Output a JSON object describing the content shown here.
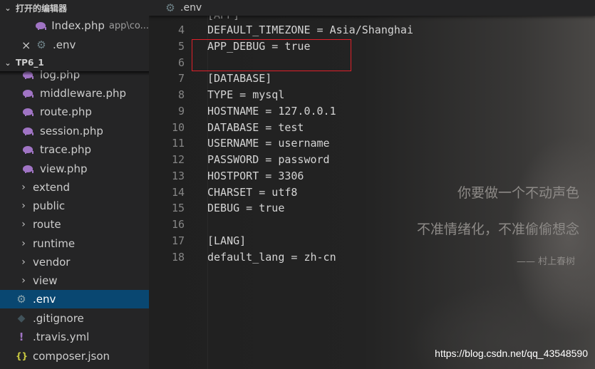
{
  "sidebar": {
    "open_editors_header": "打开的编辑器",
    "open_editors": [
      {
        "name": "Index.php",
        "desc": "app\\co..."
      },
      {
        "name": ".env",
        "close": "×"
      }
    ],
    "project_header": "TP6_1",
    "tree": [
      {
        "label": "log.php",
        "kind": "php"
      },
      {
        "label": "middleware.php",
        "kind": "php"
      },
      {
        "label": "route.php",
        "kind": "php"
      },
      {
        "label": "session.php",
        "kind": "php"
      },
      {
        "label": "trace.php",
        "kind": "php"
      },
      {
        "label": "view.php",
        "kind": "php"
      },
      {
        "label": "extend",
        "kind": "folder"
      },
      {
        "label": "public",
        "kind": "folder"
      },
      {
        "label": "route",
        "kind": "folder"
      },
      {
        "label": "runtime",
        "kind": "folder"
      },
      {
        "label": "vendor",
        "kind": "folder"
      },
      {
        "label": "view",
        "kind": "folder"
      },
      {
        "label": ".env",
        "kind": "env"
      },
      {
        "label": ".gitignore",
        "kind": "git"
      },
      {
        "label": ".travis.yml",
        "kind": "yml"
      },
      {
        "label": "composer.json",
        "kind": "json"
      }
    ]
  },
  "editor": {
    "tab": ".env",
    "partial_top": "[APP]",
    "lines": [
      {
        "n": "4",
        "text": "DEFAULT_TIMEZONE = Asia/Shanghai"
      },
      {
        "n": "5",
        "text": "APP_DEBUG = true"
      },
      {
        "n": "6",
        "text": ""
      },
      {
        "n": "7",
        "text": "[DATABASE]"
      },
      {
        "n": "8",
        "text": "TYPE = mysql"
      },
      {
        "n": "9",
        "text": "HOSTNAME = 127.0.0.1"
      },
      {
        "n": "10",
        "text": "DATABASE = test"
      },
      {
        "n": "11",
        "text": "USERNAME = username"
      },
      {
        "n": "12",
        "text": "PASSWORD = password"
      },
      {
        "n": "13",
        "text": "HOSTPORT = 3306"
      },
      {
        "n": "14",
        "text": "CHARSET = utf8"
      },
      {
        "n": "15",
        "text": "DEBUG = true"
      },
      {
        "n": "16",
        "text": ""
      },
      {
        "n": "17",
        "text": "[LANG]"
      },
      {
        "n": "18",
        "text": "default_lang = zh-cn"
      }
    ]
  },
  "background": {
    "quote_line1": "你要做一个不动声色",
    "quote_line2": "不准情绪化，不准偷偷想念",
    "quote_author": "—— 村上春树"
  },
  "watermark": "https://blog.csdn.net/qq_43548590",
  "colors": {
    "selection": "#094771",
    "php_icon": "#a074c4",
    "highlight_box": "#e0202a"
  }
}
